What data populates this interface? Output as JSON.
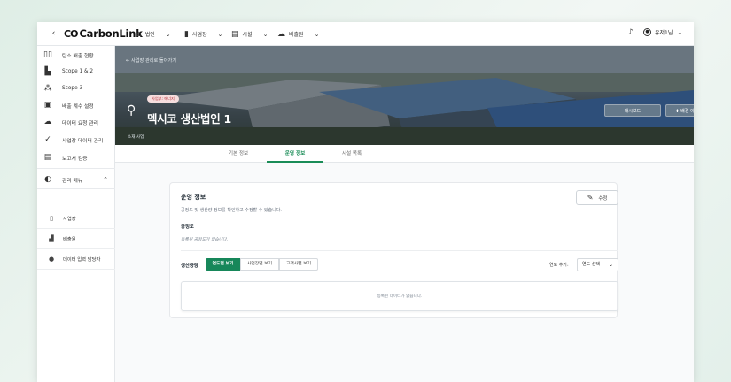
{
  "topbar": {
    "back_glyph": "‹",
    "logo_mark": "CO",
    "logo_text": "CarbonLink",
    "nav": [
      {
        "icon": "building-icon",
        "glyph": "⌂",
        "label": "법인"
      },
      {
        "icon": "chart-icon",
        "glyph": "▮",
        "label": "사업장"
      },
      {
        "icon": "facility-icon",
        "glyph": "▤",
        "label": "시설"
      },
      {
        "icon": "cloud-icon",
        "glyph": "☁",
        "label": "배출원"
      }
    ],
    "bell_glyph": "🔔",
    "user_label": "유저1님"
  },
  "sidebar": {
    "items": [
      {
        "icon": "dashboard-icon",
        "glyph": "▯▯",
        "label": "탄소 배출 현황"
      },
      {
        "icon": "scope12-icon",
        "glyph": "▙",
        "label": "Scope 1 & 2"
      },
      {
        "icon": "scope3-icon",
        "glyph": "⁂",
        "label": "Scope 3"
      },
      {
        "icon": "factor-icon",
        "glyph": "▣",
        "label": "배출 계수 설정"
      },
      {
        "icon": "upload-icon",
        "glyph": "☁",
        "label": "데이터 요청 관리"
      },
      {
        "icon": "check-icon",
        "glyph": "✓",
        "label": "사업장 데이터 관리"
      },
      {
        "icon": "report-icon",
        "glyph": "▤",
        "label": "보고서 검증"
      },
      {
        "icon": "admin-icon",
        "glyph": "◐",
        "label": "관리 메뉴"
      }
    ],
    "sub_items": [
      {
        "icon": "site-icon",
        "glyph": "▯",
        "label": "사업장"
      },
      {
        "icon": "source-icon",
        "glyph": "▟",
        "label": "배출원"
      },
      {
        "icon": "person-icon",
        "glyph": "●",
        "label": "데이터 입력 담당자"
      }
    ]
  },
  "hero": {
    "back_label": "←  사업장 관리로 돌아가기",
    "tag": "사업부: 에너지",
    "title": "멕시코 생산법인 1",
    "subtitle": "소재 사업",
    "dashboard_btn": "대시보드",
    "change_image_btn": "⬆  배경 이미지 변경"
  },
  "tabs": [
    {
      "label": "기본 정보",
      "active": false
    },
    {
      "label": "운영 정보",
      "active": true
    },
    {
      "label": "시설 목록",
      "active": false
    }
  ],
  "card": {
    "title": "운영 정보",
    "description": "공정도 및 생산량 정보를 확인하고 수정할 수 있습니다.",
    "edit_label": "수정",
    "process_label": "공정도",
    "process_empty": "등록된 공정도가 없습니다.",
    "production_label": "생산증량",
    "view_toggle": [
      {
        "label": "연도별 보기",
        "active": true
      },
      {
        "label": "사업장별 보기",
        "active": false
      },
      {
        "label": "고객사별 보기",
        "active": false
      }
    ],
    "year_add_label": "연도 추가:",
    "year_select_value": "연도 선택",
    "data_empty": "등록된 데이터가 없습니다."
  }
}
